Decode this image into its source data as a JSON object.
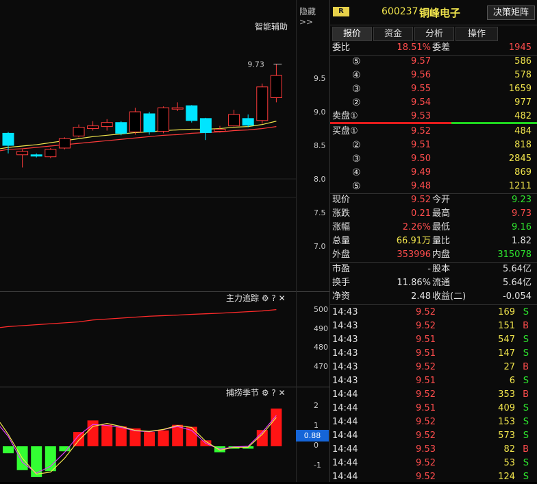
{
  "top": {
    "hide_label": "隐藏",
    "hide_arrows": ">>",
    "badge": "R",
    "code": "600237",
    "name": "铜峰电子",
    "decision_btn": "决策矩阵"
  },
  "tabs": [
    "报价",
    "资金",
    "分析",
    "操作"
  ],
  "kline": {
    "panel_label": "智能辅助",
    "high_marker": "9.73",
    "y_ticks": [
      "9.5",
      "9.0",
      "8.5",
      "8.0",
      "7.5",
      "7.0"
    ],
    "candles": [
      {
        "o": 8.7,
        "c": 8.52,
        "h": 8.72,
        "l": 8.4
      },
      {
        "o": 8.38,
        "c": 8.43,
        "h": 8.46,
        "l": 8.19
      },
      {
        "o": 8.38,
        "c": 8.36,
        "h": 8.4,
        "l": 8.34
      },
      {
        "o": 8.35,
        "c": 8.46,
        "h": 8.48,
        "l": 8.33
      },
      {
        "o": 8.48,
        "c": 8.62,
        "h": 8.64,
        "l": 8.46
      },
      {
        "o": 8.66,
        "c": 8.79,
        "h": 8.83,
        "l": 8.64
      },
      {
        "o": 8.77,
        "c": 8.81,
        "h": 8.88,
        "l": 8.74
      },
      {
        "o": 8.8,
        "c": 8.86,
        "h": 8.91,
        "l": 8.74
      },
      {
        "o": 8.86,
        "c": 8.7,
        "h": 8.88,
        "l": 8.67
      },
      {
        "o": 8.72,
        "c": 9.02,
        "h": 9.08,
        "l": 8.68
      },
      {
        "o": 8.99,
        "c": 8.72,
        "h": 9.02,
        "l": 8.68
      },
      {
        "o": 8.73,
        "c": 9.08,
        "h": 9.1,
        "l": 8.7
      },
      {
        "o": 9.06,
        "c": 9.08,
        "h": 9.16,
        "l": 9.03
      },
      {
        "o": 9.11,
        "c": 8.89,
        "h": 9.12,
        "l": 8.86
      },
      {
        "o": 8.92,
        "c": 8.71,
        "h": 8.93,
        "l": 8.6
      },
      {
        "o": 8.73,
        "c": 8.76,
        "h": 8.81,
        "l": 8.71
      },
      {
        "o": 8.81,
        "c": 8.98,
        "h": 9.05,
        "l": 8.8
      },
      {
        "o": 8.92,
        "c": 8.82,
        "h": 8.98,
        "l": 8.79
      },
      {
        "o": 8.89,
        "c": 9.39,
        "h": 9.44,
        "l": 8.84
      },
      {
        "o": 9.23,
        "c": 9.56,
        "h": 9.73,
        "l": 9.16
      }
    ],
    "ma_yellow": [
      8.49,
      8.51,
      8.53,
      8.56,
      8.59,
      8.62,
      8.65,
      8.67,
      8.69,
      8.71,
      8.72,
      8.74,
      8.75,
      8.76,
      8.76,
      8.77,
      8.79,
      8.8,
      8.83,
      8.88
    ],
    "ma_red": [
      8.46,
      8.47,
      8.49,
      8.51,
      8.53,
      8.55,
      8.57,
      8.59,
      8.61,
      8.63,
      8.65,
      8.67,
      8.68,
      8.7,
      8.71,
      8.72,
      8.74,
      8.75,
      8.77,
      8.8
    ]
  },
  "trace": {
    "label": "主力追踪",
    "y_ticks": [
      "500",
      "490",
      "480",
      "470"
    ],
    "line": [
      491.5,
      492,
      492.5,
      493,
      493.5,
      494,
      495,
      495.5,
      496,
      496.5,
      497,
      497.3,
      497.6,
      498,
      498.3,
      498.6,
      499,
      499.4,
      499.8,
      500.5
    ]
  },
  "season": {
    "label": "捕捞季节",
    "y_ticks": [
      "2",
      "1",
      "0",
      "-1"
    ],
    "current": "0.88",
    "bars": [
      -0.35,
      -1.2,
      -1.55,
      -1.25,
      -0.25,
      0.72,
      1.3,
      1.08,
      1.0,
      0.9,
      0.72,
      0.8,
      1.08,
      0.98,
      0.3,
      -0.3,
      -0.12,
      -0.12,
      0.82,
      1.9
    ],
    "line_yellow": [
      0.6,
      -0.6,
      -1.4,
      -1.3,
      -0.6,
      0.3,
      1.0,
      1.15,
      1.0,
      0.8,
      0.75,
      0.85,
      1.05,
      0.95,
      0.25,
      -0.2,
      -0.05,
      -0.05,
      0.6,
      1.45
    ],
    "line_purple": [
      0.5,
      -0.8,
      -1.35,
      -1.0,
      -0.3,
      0.55,
      1.1,
      1.05,
      0.95,
      0.78,
      0.73,
      0.84,
      1.0,
      0.8,
      0.15,
      -0.15,
      -0.03,
      0.0,
      0.7,
      1.55
    ]
  },
  "quote": {
    "weibi_label": "委比",
    "weibi": "18.51%",
    "weicha_label": "委差",
    "weicha": "1945",
    "asks": [
      {
        "lv": "⑤",
        "price": "9.57",
        "vol": "586"
      },
      {
        "lv": "④",
        "price": "9.56",
        "vol": "578"
      },
      {
        "lv": "③",
        "price": "9.55",
        "vol": "1659"
      },
      {
        "lv": "②",
        "price": "9.54",
        "vol": "977"
      },
      {
        "lv": "卖盘①",
        "price": "9.53",
        "vol": "482"
      }
    ],
    "bids": [
      {
        "lv": "买盘①",
        "price": "9.52",
        "vol": "484"
      },
      {
        "lv": "②",
        "price": "9.51",
        "vol": "818"
      },
      {
        "lv": "③",
        "price": "9.50",
        "vol": "2845"
      },
      {
        "lv": "④",
        "price": "9.49",
        "vol": "869"
      },
      {
        "lv": "⑤",
        "price": "9.48",
        "vol": "1211"
      }
    ],
    "stats": [
      [
        "现价",
        "9.52",
        "今开",
        "9.23"
      ],
      [
        "涨跌",
        "0.21",
        "最高",
        "9.73"
      ],
      [
        "涨幅",
        "2.26%",
        "最低",
        "9.16"
      ],
      [
        "总量",
        "66.91万",
        "量比",
        "1.82"
      ],
      [
        "外盘",
        "353996",
        "内盘",
        "315078"
      ],
      [
        "市盈",
        "-",
        "股本",
        "5.64亿"
      ],
      [
        "换手",
        "11.86%",
        "流通",
        "5.64亿"
      ],
      [
        "净资",
        "2.48",
        "收益(二)",
        "-0.054"
      ]
    ]
  },
  "ticks": [
    {
      "t": "14:43",
      "p": "9.52",
      "v": "169",
      "s": "S"
    },
    {
      "t": "14:43",
      "p": "9.52",
      "v": "151",
      "s": "B"
    },
    {
      "t": "14:43",
      "p": "9.51",
      "v": "547",
      "s": "S"
    },
    {
      "t": "14:43",
      "p": "9.51",
      "v": "147",
      "s": "S"
    },
    {
      "t": "14:43",
      "p": "9.52",
      "v": "27",
      "s": "B"
    },
    {
      "t": "14:43",
      "p": "9.51",
      "v": "6",
      "s": "S"
    },
    {
      "t": "14:44",
      "p": "9.52",
      "v": "353",
      "s": "B"
    },
    {
      "t": "14:44",
      "p": "9.51",
      "v": "409",
      "s": "S"
    },
    {
      "t": "14:44",
      "p": "9.52",
      "v": "153",
      "s": "S"
    },
    {
      "t": "14:44",
      "p": "9.52",
      "v": "573",
      "s": "S"
    },
    {
      "t": "14:44",
      "p": "9.53",
      "v": "82",
      "s": "B"
    },
    {
      "t": "14:44",
      "p": "9.52",
      "v": "53",
      "s": "S"
    },
    {
      "t": "14:44",
      "p": "9.52",
      "v": "124",
      "s": "S"
    }
  ],
  "colors": {
    "up": "#ff3b3b",
    "down": "#00e5ff",
    "ma5": "#f2e64d",
    "ma10": "#ff3b3b",
    "bar_up": "#ff1414",
    "bar_down": "#33ff33"
  }
}
